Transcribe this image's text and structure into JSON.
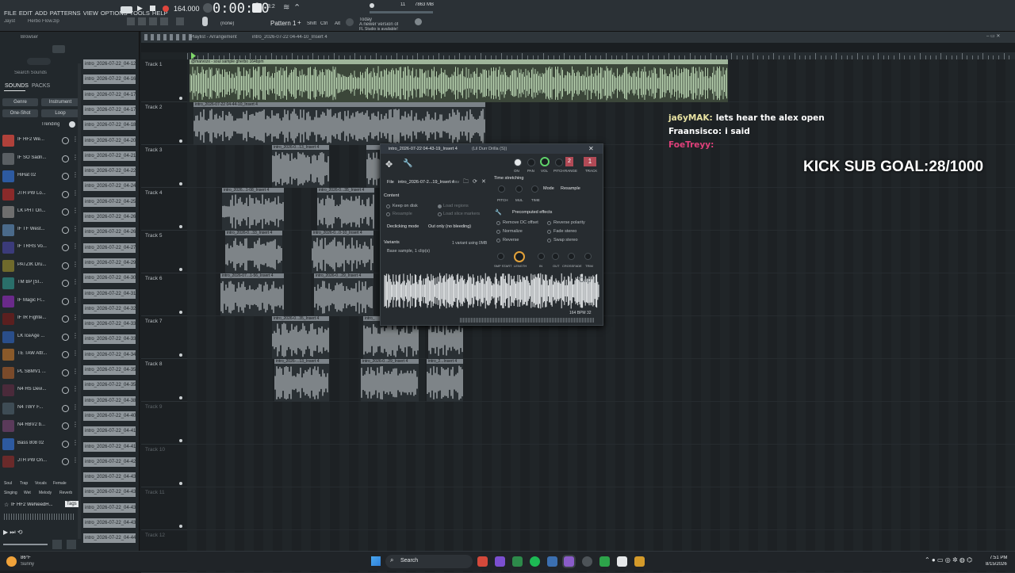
{
  "menu": {
    "items": [
      "FILE",
      "EDIT",
      "ADD",
      "PATTERNS",
      "VIEW",
      "OPTIONS",
      "TOOLS",
      "HELP"
    ]
  },
  "transport": {
    "bpm": "164.000",
    "time": "0:00:00",
    "pattern": "Pattern 1",
    "pattern_mode": "(none)",
    "bar_beat": "3:2",
    "meters": [
      "11",
      "7863 MB"
    ],
    "update_notice": [
      "Today",
      "A newer version of",
      "FL Studio is available!"
    ],
    "mode_buttons": [
      "Shift",
      "Ctrl",
      "Alt"
    ]
  },
  "left_header": {
    "user": "Jayst",
    "project": "Herbo Flow.zip",
    "browser_label": "Browser",
    "search_placeholder": "Search Sounds",
    "tab_sounds": "SOUNDS",
    "tab_packs": "PACKS",
    "filters": [
      "Genre",
      "Instrument",
      "One-Shot",
      "Loop"
    ],
    "sort": "Trending"
  },
  "browser_items": [
    {
      "label": "IF HF2 We...",
      "color": "#b0413a"
    },
    {
      "label": "IF SO Sadn...",
      "color": "#5a5f63"
    },
    {
      "label": "HiHat 02",
      "color": "#2d5aa0"
    },
    {
      "label": "JTH PW Lo...",
      "color": "#8a2a2a"
    },
    {
      "label": "LK PHT On...",
      "color": "#6e6e6e"
    },
    {
      "label": "IF TF West...",
      "color": "#4a6a8a"
    },
    {
      "label": "IF TRHS Vo...",
      "color": "#3b3b7a"
    },
    {
      "label": "PATZIK Dru...",
      "color": "#6f6a2c"
    },
    {
      "label": "TM BP [SI...",
      "color": "#2a6f6a"
    },
    {
      "label": "IF Magic Fl...",
      "color": "#6a2a8a"
    },
    {
      "label": "IF IR Fighte...",
      "color": "#5a1f1f"
    },
    {
      "label": "LK IceAge ...",
      "color": "#2a4e8a"
    },
    {
      "label": "TE TAW Attr...",
      "color": "#8a5a2a"
    },
    {
      "label": "PL SBMV1 ...",
      "color": "#7a4a2a"
    },
    {
      "label": "N4 HS Devi...",
      "color": "#4a2a3a"
    },
    {
      "label": "N4 TWY F...",
      "color": "#3e4c55"
    },
    {
      "label": "N4 RBV2 b...",
      "color": "#5a3a5a"
    },
    {
      "label": "Bass 808 02",
      "color": "#2d5aa0"
    },
    {
      "label": "JTH PW On...",
      "color": "#6a2a2a"
    }
  ],
  "clip_list": [
    "intro_2026-07-22_04-12...",
    "intro_2026-07-22_04-16...",
    "intro_2026-07-22_04-17...",
    "intro_2026-07-22_04-17...",
    "intro_2026-07-22_04-18...",
    "intro_2026-07-22_04-20...",
    "intro_2026-07-22_04-21...",
    "intro_2026-07-22_04-22...",
    "intro_2026-07-22_04-24...",
    "intro_2026-07-22_04-25...",
    "intro_2026-07-22_04-26...",
    "intro_2026-07-22_04-26...",
    "intro_2026-07-22_04-27...",
    "intro_2026-07-22_04-29...",
    "intro_2026-07-22_04-30...",
    "intro_2026-07-22_04-31...",
    "intro_2026-07-22_04-32...",
    "intro_2026-07-22_04-33...",
    "intro_2026-07-22_04-33...",
    "intro_2026-07-22_04-34...",
    "intro_2026-07-22_04-35...",
    "intro_2026-07-22_04-35...",
    "intro_2026-07-22_04-38...",
    "intro_2026-07-22_04-40...",
    "intro_2026-07-22_04-41...",
    "intro_2026-07-22_04-41...",
    "intro_2026-07-22_04-42...",
    "intro_2026-07-22_04-43...",
    "intro_2026-07-22_04-43...",
    "intro_2026-07-22_04-43...",
    "intro_2026-07-22_04-43...",
    "intro_2026-07-22_04-44..."
  ],
  "bottom_left": {
    "tags": [
      "Soul",
      "Trap",
      "Vocals",
      "Female",
      "Singing",
      "Wet",
      "Melody",
      "Reverb"
    ],
    "preview": "IF HF2 WeNeedH...",
    "preview_tag": "Tags"
  },
  "playlist": {
    "title": "Playlist - Arrangement",
    "path": "intro_2026-07-22 04-44-10_Insert 4"
  },
  "tracks": [
    "Track 1",
    "Track 2",
    "Track 3",
    "Track 4",
    "Track 5",
    "Track 6",
    "Track 7",
    "Track 8",
    "Track 9",
    "Track 10",
    "Track 11",
    "Track 12"
  ],
  "clip_names": {
    "t1": "@marvozx - soul sample gherbo 164bpm",
    "t2": "intro_2026-07-22 04-44-10_Insert 4",
    "t3": "intro_2026-0...13_Insert 4",
    "t4a": "intro_2026...1-08_Insert 4",
    "t4b": "intro_2026-0...35_Insert 4",
    "t5a": "intro_2026-0...33_Insert 4",
    "t5b": "intro_2026-0...0-10_Insert 4",
    "t6a": "intro_2026-07...1-56_Insert 4",
    "t6b": "intro_2026-0...29_Insert 4",
    "t7a": "intro_2026-0...35_Insert 4",
    "t7b": "intro_",
    "t8a": "intro_2026-...13_Insert 4",
    "t8b": "intro_2026-0...29_Insert 4",
    "t8c": "intro_2...Insert 4"
  },
  "sample_window": {
    "title": "intro_2026-07-22 04-43-19_Insert 4",
    "subtitle": "(Lil Durr Drilla (S))",
    "file_label": "File",
    "file_name": "intro_2026-07-2...19_Insert 4",
    "file_ext": ".wav",
    "knob_labels": [
      "ON",
      "PAN",
      "VOL",
      "PITCH",
      "RANGE",
      "TRACK"
    ],
    "range": "2",
    "track_num": "1",
    "content_label": "Content",
    "keep_on_disk": "Keep on disk",
    "resample": "Resample",
    "load_regions": "Load regions",
    "load_slice": "Load slice markers",
    "declick_label": "Declicking mode",
    "declick_value": "Out only (no bleeding)",
    "variants_label": "Variants",
    "variants_value": "1 variant using 0MB",
    "base_sample": "Base sample, 1 clip(s)",
    "time_stretching": "Time stretching",
    "ts_knobs": [
      "PITCH",
      "MUL",
      "TIME"
    ],
    "mode_label": "Mode",
    "mode_value": "Resample",
    "precomputed": "Precomputed effects",
    "effects_left": [
      "Remove DC offset",
      "Normalize",
      "Reverse"
    ],
    "effects_right": [
      "Reverse polarity",
      "Fade stereo",
      "Swap stereo"
    ],
    "env_knobs": [
      "SMP START",
      "LENGTH",
      "IN",
      "OUT",
      "CROSSFADE",
      "TRIM"
    ],
    "bpm_readout": "164 BPM 32",
    "clip_word": "Clip"
  },
  "overlay": {
    "chat": [
      {
        "user": "ja6yMAK:",
        "msg": "lets hear the alex open",
        "color": "#e8e2a2"
      },
      {
        "user": "Fraansisco:",
        "msg": "i said",
        "color": "#ffffff"
      },
      {
        "user": "FoeTreyy:",
        "msg": "",
        "color": "#e0407a"
      }
    ],
    "goal": "KICK SUB GOAL:28/1000"
  },
  "taskbar": {
    "weather_temp": "86°F",
    "weather_desc": "Sunny",
    "search": "Search",
    "time": "7:51 PM",
    "date": "8/15/2026"
  }
}
